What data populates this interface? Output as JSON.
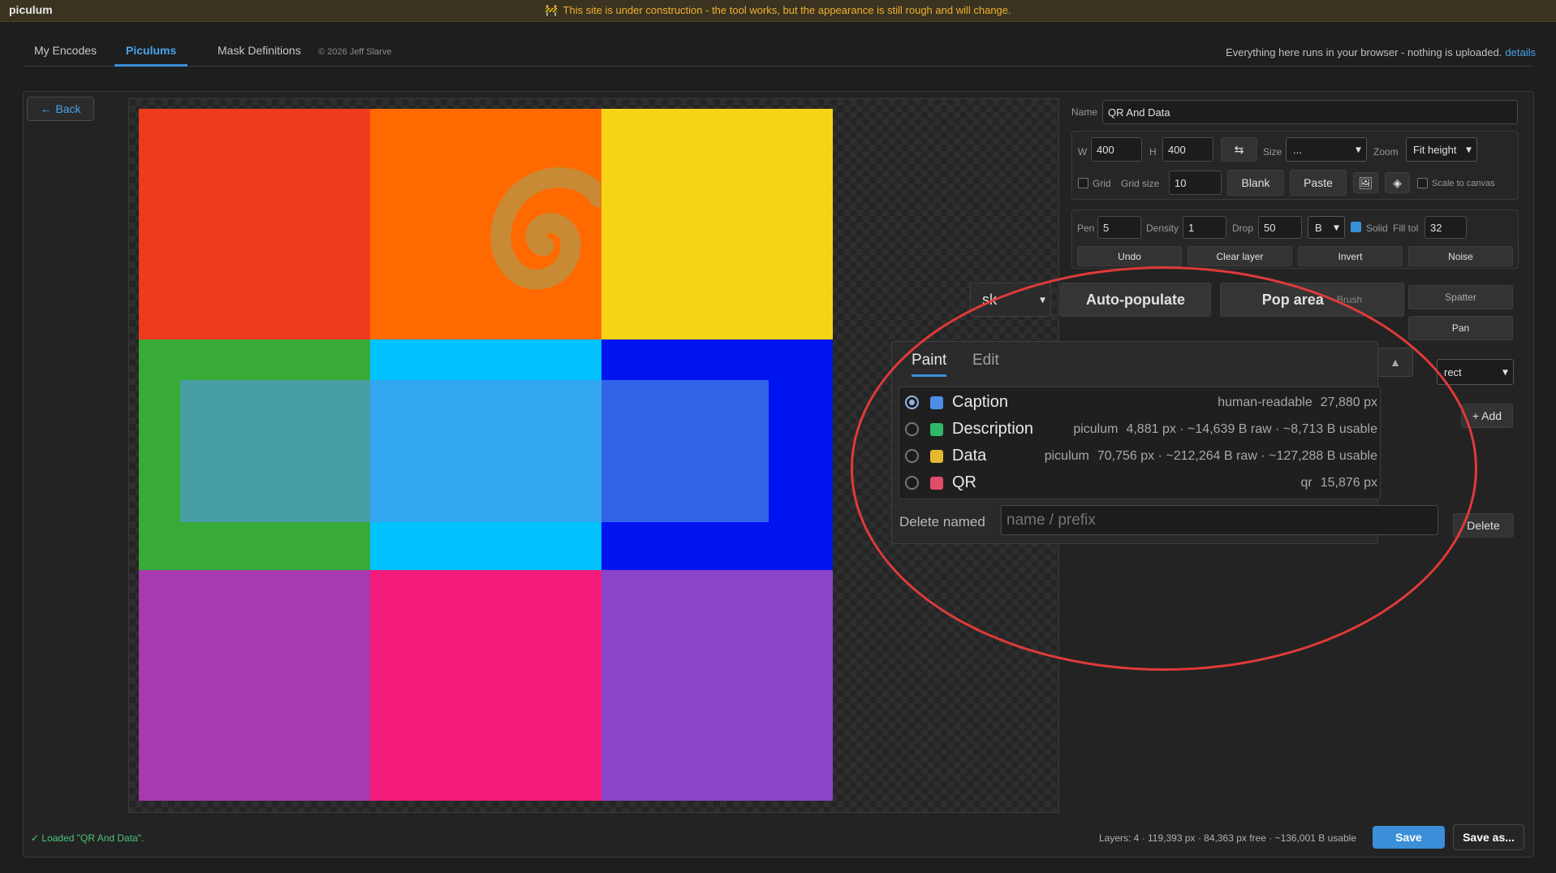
{
  "app": {
    "brand": "piculum",
    "banner": "This site is under construction - the tool works, but the appearance is still rough and will change."
  },
  "nav": {
    "tabs": [
      {
        "label": "My Encodes"
      },
      {
        "label": "Piculums"
      },
      {
        "label": "Mask Definitions"
      }
    ],
    "copyright": "© 2026 Jeff Slarve",
    "privacy": "Everything here runs in your browser - nothing is uploaded.",
    "details_link": "details"
  },
  "editor": {
    "back_label": "Back",
    "name_label": "Name",
    "name_value": "QR And Data",
    "w_label": "W",
    "w_value": "400",
    "h_label": "H",
    "h_value": "400",
    "size_label": "Size",
    "size_value": "...",
    "zoom_label": "Zoom",
    "zoom_value": "Fit height",
    "grid_label": "Grid",
    "grid_size_label": "Grid size",
    "grid_size_value": "10",
    "blank_label": "Blank",
    "paste_label": "Paste",
    "scale_label": "Scale to canvas",
    "pen_label": "Pen",
    "pen_value": "5",
    "density_label": "Density",
    "density_value": "1",
    "drop_label": "Drop",
    "drop_value": "50",
    "channel_value": "B",
    "solid_label": "Solid",
    "filltol_label": "Fill tol",
    "filltol_value": "32",
    "undo_label": "Undo",
    "clear_label": "Clear layer",
    "invert_label": "Invert",
    "noise_label": "Noise",
    "mask_select": "sk",
    "autopop_label": "Auto-populate",
    "poparea_label": "Pop area",
    "brush_label": "Brush",
    "spatter_label": "Spatter",
    "pan_label": "Pan",
    "shape_value": "rect",
    "add_label": "+ Add",
    "paint_tab": "Paint",
    "edit_tab": "Edit",
    "delete_named_label": "Delete named",
    "delete_placeholder": "name / prefix",
    "delete_label": "Delete"
  },
  "layers": [
    {
      "name": "Caption",
      "kind": "human-readable",
      "meta": "27,880 px",
      "color": "#4d8fe6",
      "selected": true
    },
    {
      "name": "Description",
      "kind": "piculum",
      "meta": "4,881 px · ~14,639 B raw · ~8,713 B usable",
      "color": "#2fb86a",
      "selected": false
    },
    {
      "name": "Data",
      "kind": "piculum",
      "meta": "70,756 px · ~212,264 B raw · ~127,288 B usable",
      "color": "#e6b830",
      "selected": false
    },
    {
      "name": "QR",
      "kind": "qr",
      "meta": "15,876 px",
      "color": "#e04c6a",
      "selected": false
    }
  ],
  "canvas": {
    "cells": [
      "#f03a1c",
      "#ff6a00",
      "#f5d417",
      "#38aa38",
      "#00c2ff",
      "#0014f0",
      "#a83ab0",
      "#f21a7a",
      "#8a44c8"
    ],
    "spiral_color": "#c98a36"
  },
  "footer": {
    "status": "✓ Loaded \"QR And Data\".",
    "layers_info": "Layers: 4 · 119,393 px · 84,363 px free · ~136,001 B usable",
    "save_label": "Save",
    "saveas_label": "Save as..."
  },
  "colors": {
    "accent": "#3a8fd8",
    "annotation": "#e03a3a",
    "banner": "#f0b030"
  }
}
